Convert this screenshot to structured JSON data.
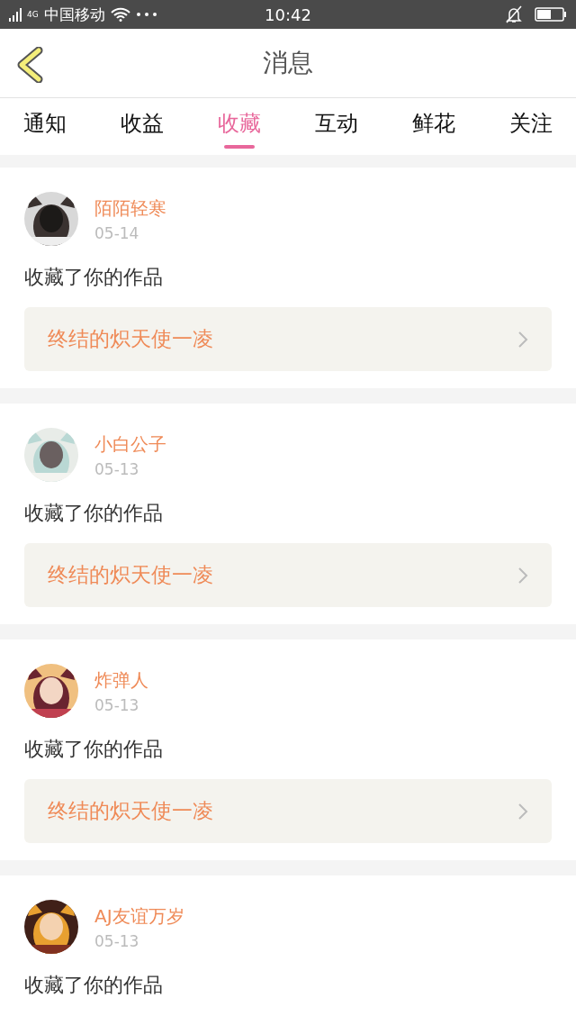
{
  "status_bar": {
    "carrier": "中国移动",
    "time": "10:42",
    "network": "4G"
  },
  "header": {
    "title": "消息"
  },
  "tabs": [
    {
      "label": "通知",
      "selected": false
    },
    {
      "label": "收益",
      "selected": false
    },
    {
      "label": "收藏",
      "selected": true
    },
    {
      "label": "互动",
      "selected": false
    },
    {
      "label": "鲜花",
      "selected": false
    },
    {
      "label": "关注",
      "selected": false
    }
  ],
  "messages": [
    {
      "user": "陌陌轻寒",
      "date": "05-14",
      "action": "收藏了你的作品",
      "work": "终结的炽天使一凌"
    },
    {
      "user": "小白公子",
      "date": "05-13",
      "action": "收藏了你的作品",
      "work": "终结的炽天使一凌"
    },
    {
      "user": "炸弹人",
      "date": "05-13",
      "action": "收藏了你的作品",
      "work": "终结的炽天使一凌"
    },
    {
      "user": "AJ友谊万岁",
      "date": "05-13",
      "action": "收藏了你的作品"
    }
  ]
}
